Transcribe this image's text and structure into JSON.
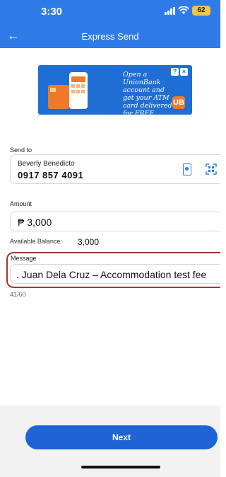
{
  "status_bar": {
    "time": "3:30",
    "battery": "62"
  },
  "header": {
    "back_icon": "arrow-left-icon",
    "title": "Express Send"
  },
  "banner": {
    "text": "Open a UnionBank account and get your ATM card delivered for FREE",
    "logo": "UB"
  },
  "send_to": {
    "label": "Send to",
    "name": "Beverly Benedicto",
    "number": "0917 857 4091"
  },
  "amount": {
    "label": "Amount",
    "value": "₱ 3,000"
  },
  "balance": {
    "label": "Available Balance:",
    "value": "3,000"
  },
  "message": {
    "label": "Message",
    "value": ". Juan Dela Cruz – Accommodation test fee",
    "counter": "41/60"
  },
  "actions": {
    "next_label": "Next"
  },
  "colors": {
    "primary": "#2f7be8",
    "button": "#1e64d6",
    "highlight": "#a33636"
  }
}
